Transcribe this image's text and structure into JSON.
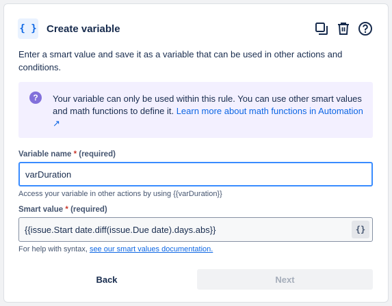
{
  "header": {
    "icon": "{ }",
    "title": "Create variable",
    "actions": [
      "duplicate-icon",
      "trash-icon",
      "help-icon"
    ]
  },
  "description": "Enter a smart value and save it as a variable that can be used in other actions and conditions.",
  "info": {
    "text": "Your variable can only be used within this rule. You can use other smart values and math functions to define it.",
    "link": "Learn more about math functions in Automation ↗"
  },
  "variable_name": {
    "label": "Variable name",
    "required": "(required)",
    "value": "varDuration",
    "help": "Access your variable in other actions by using {{varDuration}}"
  },
  "smart_value": {
    "label": "Smart value",
    "required": "(required)",
    "value": "{{issue.Start date.diff(issue.Due date).days.abs}}",
    "button": "{}",
    "help_prefix": "For help with syntax,",
    "help_link": "see our smart values documentation."
  },
  "buttons": {
    "back": "Back",
    "next": "Next"
  }
}
